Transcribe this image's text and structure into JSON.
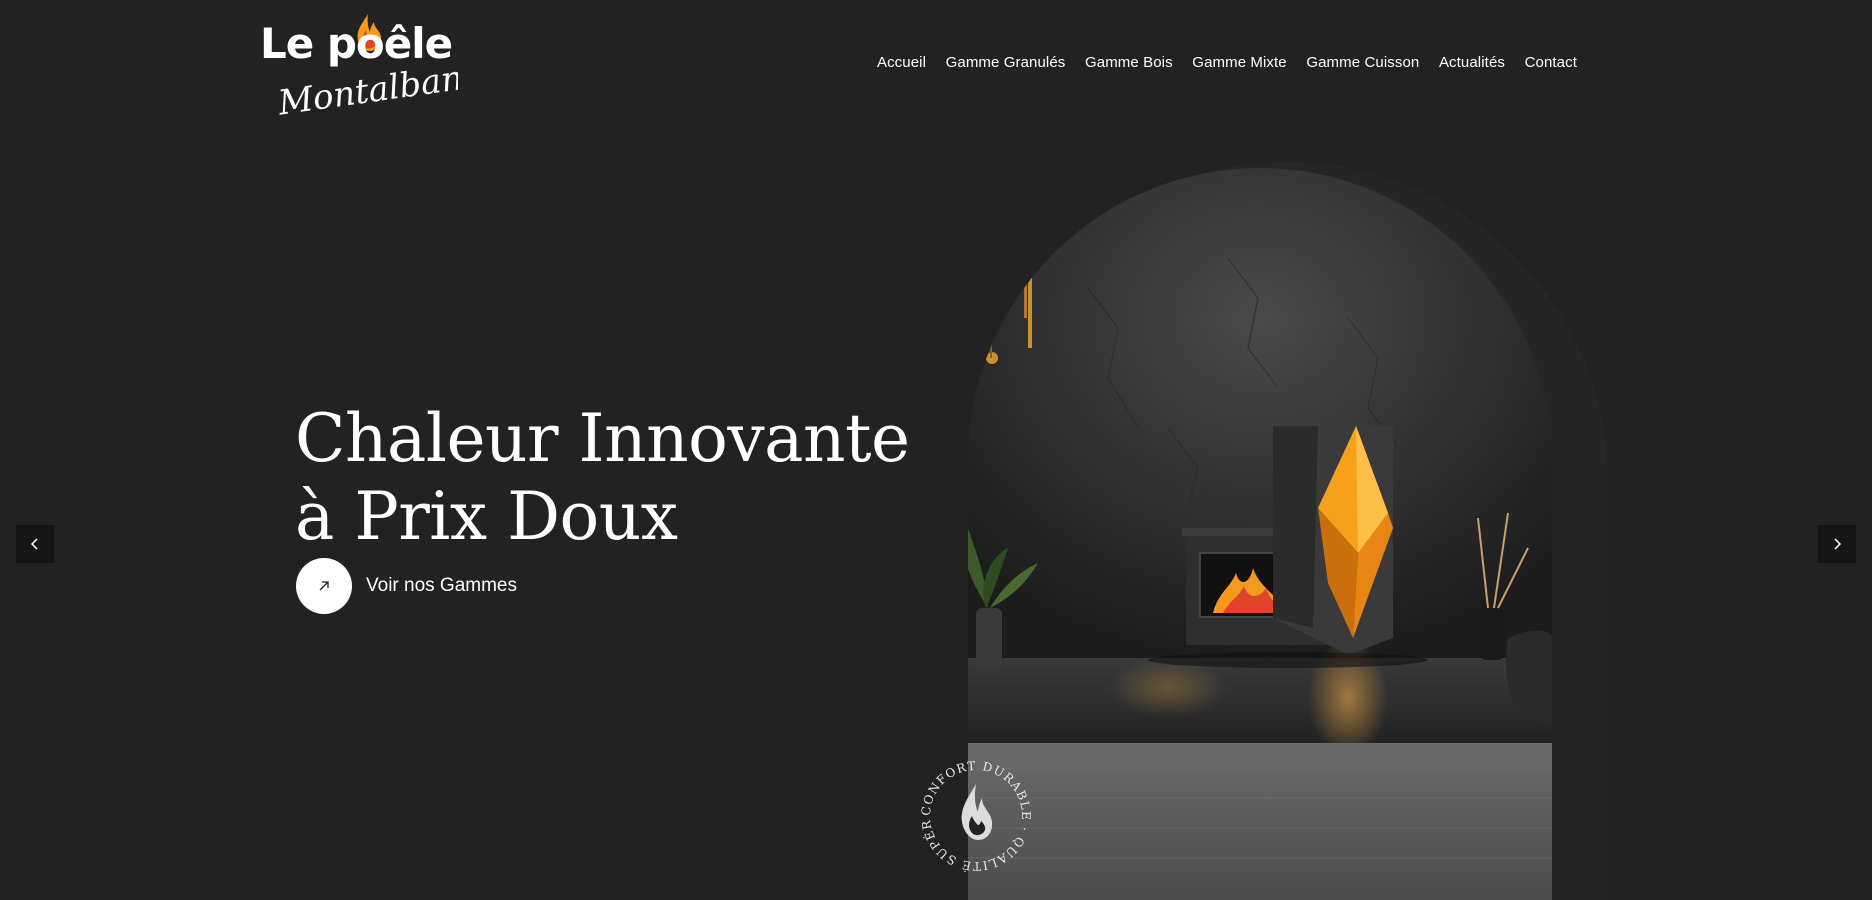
{
  "brand": {
    "line1": "Le poêle",
    "line2": "Montalbanais"
  },
  "nav": {
    "items": [
      {
        "label": "Accueil"
      },
      {
        "label": "Gamme Granulés"
      },
      {
        "label": "Gamme Bois"
      },
      {
        "label": "Gamme Mixte"
      },
      {
        "label": "Gamme Cuisson"
      },
      {
        "label": "Actualités"
      },
      {
        "label": "Contact"
      }
    ]
  },
  "hero": {
    "title_line1": "Chaleur Innovante",
    "title_line2": "à Prix Doux",
    "cta_label": "Voir nos Gammes"
  },
  "badge": {
    "text": "CONFORT DURABLE · QUALITÉ SUPÉRIEURE ·"
  },
  "icons": {
    "cta": "arrow-up-right-icon",
    "prev": "chevron-left-icon",
    "next": "chevron-right-icon",
    "flame": "flame-icon"
  },
  "colors": {
    "background": "#222222",
    "text": "#ffffff",
    "accent_orange": "#f39a1e",
    "accent_red": "#e0452a"
  }
}
